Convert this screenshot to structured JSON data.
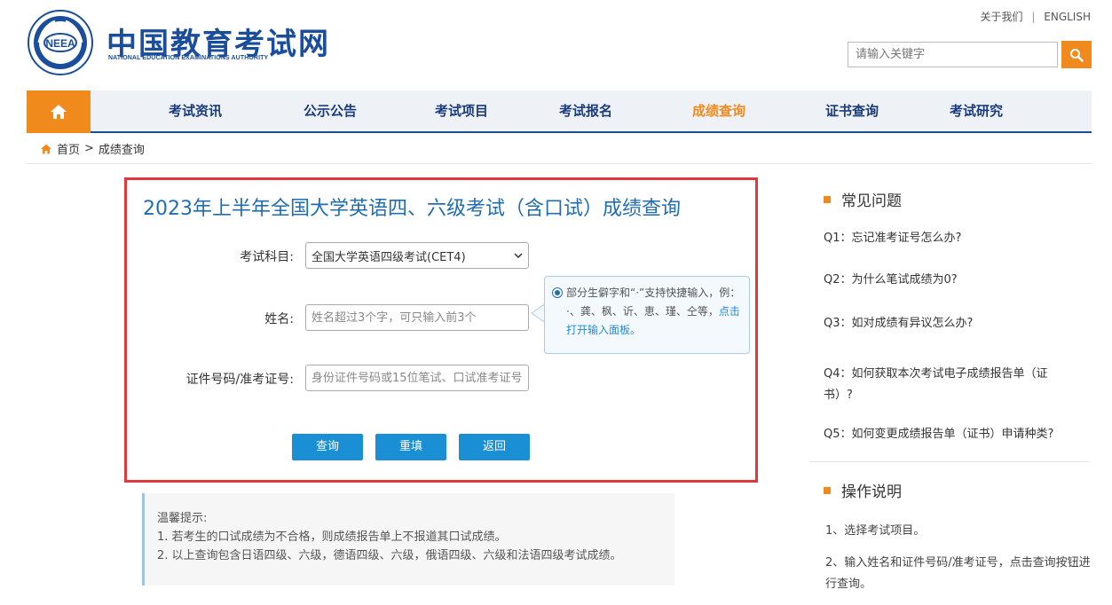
{
  "header": {
    "site_title": "中国教育考试网",
    "site_subtitle": "NATIONAL EDUCATION EXAMINATIONS AUTHORITY",
    "emblem_text": "NEEA",
    "top_links": {
      "about": "关于我们",
      "separator": "|",
      "english": "ENGLISH"
    },
    "search": {
      "placeholder": "请输入关键字"
    }
  },
  "nav": {
    "items": [
      {
        "label": "考试资讯"
      },
      {
        "label": "公示公告"
      },
      {
        "label": "考试项目"
      },
      {
        "label": "考试报名"
      },
      {
        "label": "成绩查询",
        "active": true
      },
      {
        "label": "证书查询"
      },
      {
        "label": "考试研究"
      }
    ]
  },
  "breadcrumb": {
    "home": "首页",
    "separator": ">",
    "current": "成绩查询"
  },
  "form": {
    "title": "2023年上半年全国大学英语四、六级考试（含口试）成绩查询",
    "subject_label": "考试科目:",
    "subject_value": "全国大学英语四级考试(CET4)",
    "name_label": "姓名:",
    "name_placeholder": "姓名超过3个字，可只输入前3个",
    "id_label": "证件号码/准考证号:",
    "id_placeholder": "身份证件号码或15位笔试、口试准考证号",
    "tip_text": "部分生僻字和“·”支持快捷输入，例：·、龚、枫、䜣、恵、瑾、仝等，",
    "tip_link": "点击打开输入面板。",
    "buttons": {
      "query": "查询",
      "reset": "重填",
      "back": "返回"
    }
  },
  "notice": {
    "title": "温馨提示:",
    "lines": [
      "1. 若考生的口试成绩为不合格，则成绩报告单上不报道其口试成绩。",
      "2. 以上查询包含日语四级、六级，德语四级、六级，俄语四级、六级和法语四级考试成绩。"
    ]
  },
  "sidebar": {
    "faq_title": "常见问题",
    "faqs": [
      "Q1：忘记准考证号怎么办?",
      "Q2：为什么笔试成绩为0?",
      "Q3：如对成绩有异议怎么办?",
      "Q4：如何获取本次考试电子成绩报告单（证书）?",
      "Q5：如何变更成绩报告单（证书）申请种类?"
    ],
    "ops_title": "操作说明",
    "ops": [
      "1、选择考试项目。",
      "2、输入姓名和证件号码/准考证号，点击查询按钮进行查询。"
    ]
  },
  "colors": {
    "brand_blue": "#1a4e9c",
    "accent_orange": "#f08a1c",
    "button_blue": "#1b8fd6",
    "highlight_red": "#e0393b"
  }
}
